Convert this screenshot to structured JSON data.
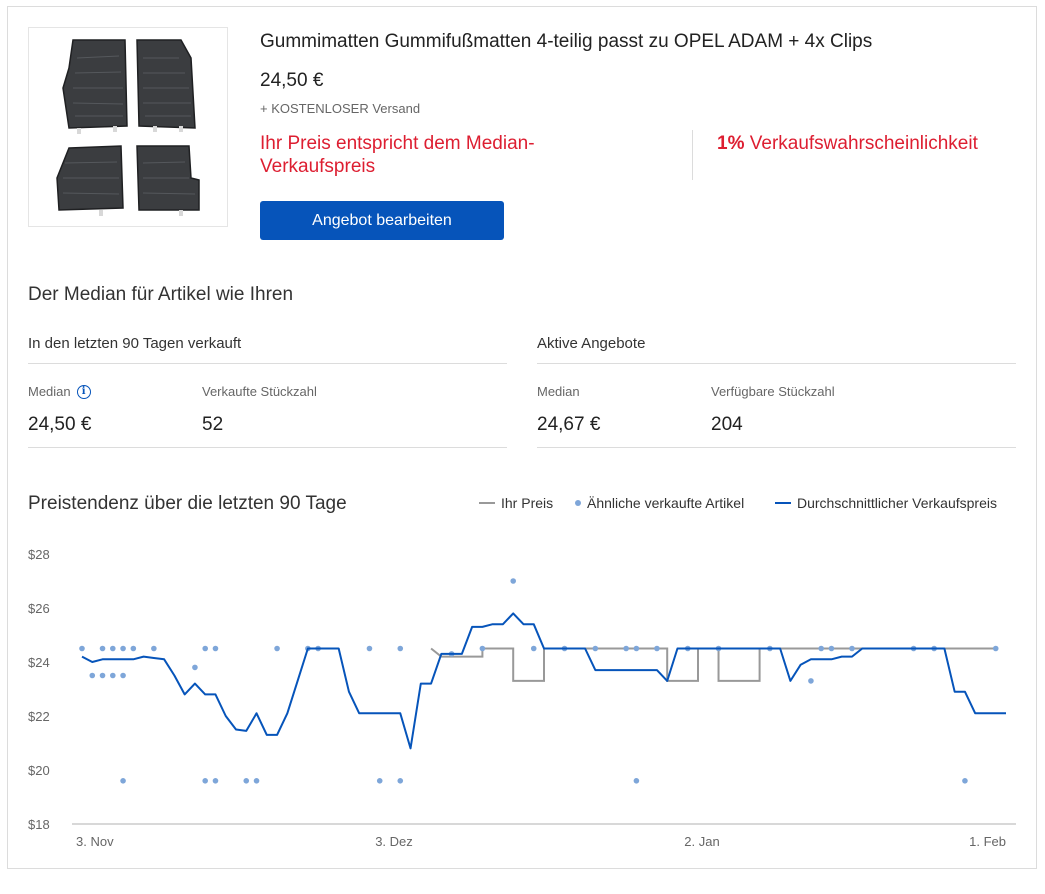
{
  "listing": {
    "title": "Gummimatten Gummifußmatten 4-teilig passt zu OPEL ADAM + 4x Clips",
    "price": "24,50 €",
    "shipping": "+ KOSTENLOSER Versand",
    "median_note": "Ihr Preis entspricht dem Median-Verkaufspreis",
    "probability_value": "1%",
    "probability_label": "Verkaufswahrscheinlichkeit",
    "edit_button": "Angebot bearbeiten"
  },
  "median_section": {
    "title": "Der Median für Artikel wie Ihren",
    "sold": {
      "heading": "In den letzten 90 Tagen verkauft",
      "median_label": "Median",
      "median_value": "24,50 €",
      "count_label": "Verkaufte Stückzahl",
      "count_value": "52"
    },
    "active": {
      "heading": "Aktive Angebote",
      "median_label": "Median",
      "median_value": "24,67 €",
      "count_label": "Verfügbare Stückzahl",
      "count_value": "204"
    }
  },
  "colors": {
    "accent": "#0654ba",
    "alert": "#dd1e31",
    "your_price_line": "#999999",
    "dots": "#7ea6d9",
    "avg_line": "#0654ba"
  },
  "chart_data": {
    "type": "line",
    "title": "Preistendenz über die letzten 90 Tage",
    "ylim": [
      18,
      28
    ],
    "y_ticks": [
      "$28",
      "$26",
      "$24",
      "$22",
      "$20",
      "$18"
    ],
    "y_tick_values": [
      28,
      26,
      24,
      22,
      20,
      18
    ],
    "x_range": [
      0,
      90
    ],
    "x_ticks": [
      {
        "label": "3. Nov",
        "day": 0
      },
      {
        "label": "3. Dez",
        "day": 30
      },
      {
        "label": "2. Jan",
        "day": 60
      },
      {
        "label": "1. Feb",
        "day": 89
      }
    ],
    "legend": [
      "Ihr Preis",
      "Ähnliche verkaufte Artikel",
      "Durchschnittlicher Verkaufspreis"
    ],
    "series": [
      {
        "name": "Ihr Preis",
        "type": "step",
        "points": [
          [
            34,
            24.5
          ],
          [
            35,
            24.2
          ],
          [
            39,
            24.2
          ],
          [
            39,
            24.5
          ],
          [
            42,
            24.5
          ],
          [
            42,
            23.3
          ],
          [
            45,
            23.3
          ],
          [
            45,
            24.5
          ],
          [
            57,
            24.5
          ],
          [
            57,
            23.3
          ],
          [
            60,
            23.3
          ],
          [
            60,
            24.5
          ],
          [
            62,
            24.5
          ],
          [
            62,
            23.3
          ],
          [
            66,
            23.3
          ],
          [
            66,
            24.5
          ],
          [
            89,
            24.5
          ]
        ]
      },
      {
        "name": "Ähnliche verkaufte Artikel",
        "type": "scatter",
        "points": [
          [
            0,
            24.5
          ],
          [
            1,
            23.5
          ],
          [
            2,
            24.5
          ],
          [
            2,
            23.5
          ],
          [
            3,
            24.5
          ],
          [
            3,
            23.5
          ],
          [
            4,
            24.5
          ],
          [
            4,
            23.5
          ],
          [
            4,
            19.6
          ],
          [
            5,
            24.5
          ],
          [
            7,
            24.5
          ],
          [
            11,
            23.8
          ],
          [
            12,
            24.5
          ],
          [
            12,
            19.6
          ],
          [
            13,
            24.5
          ],
          [
            13,
            19.6
          ],
          [
            16,
            19.6
          ],
          [
            17,
            19.6
          ],
          [
            19,
            24.5
          ],
          [
            22,
            24.5
          ],
          [
            23,
            24.5
          ],
          [
            28,
            24.5
          ],
          [
            29,
            19.6
          ],
          [
            31,
            24.5
          ],
          [
            31,
            19.6
          ],
          [
            36,
            24.3
          ],
          [
            39,
            24.5
          ],
          [
            42,
            27
          ],
          [
            44,
            24.5
          ],
          [
            47,
            24.5
          ],
          [
            50,
            24.5
          ],
          [
            53,
            24.5
          ],
          [
            54,
            24.5
          ],
          [
            54,
            19.6
          ],
          [
            56,
            24.5
          ],
          [
            59,
            24.5
          ],
          [
            62,
            24.5
          ],
          [
            67,
            24.5
          ],
          [
            71,
            23.3
          ],
          [
            72,
            24.5
          ],
          [
            73,
            24.5
          ],
          [
            75,
            24.5
          ],
          [
            81,
            24.5
          ],
          [
            83,
            24.5
          ],
          [
            86,
            19.6
          ],
          [
            89,
            24.5
          ]
        ]
      },
      {
        "name": "Durchschnittlicher Verkaufspreis",
        "type": "line",
        "points": [
          [
            0,
            24.2
          ],
          [
            1,
            24.0
          ],
          [
            2,
            24.1
          ],
          [
            3,
            24.1
          ],
          [
            4,
            24.1
          ],
          [
            5,
            24.1
          ],
          [
            6,
            24.2
          ],
          [
            7,
            24.15
          ],
          [
            8,
            24.1
          ],
          [
            9,
            23.5
          ],
          [
            10,
            22.8
          ],
          [
            11,
            23.2
          ],
          [
            12,
            22.8
          ],
          [
            13,
            22.8
          ],
          [
            14,
            22.0
          ],
          [
            15,
            21.5
          ],
          [
            16,
            21.45
          ],
          [
            17,
            22.1
          ],
          [
            18,
            21.3
          ],
          [
            19,
            21.3
          ],
          [
            20,
            22.1
          ],
          [
            21,
            23.3
          ],
          [
            22,
            24.5
          ],
          [
            23,
            24.5
          ],
          [
            24,
            24.5
          ],
          [
            25,
            24.5
          ],
          [
            26,
            22.9
          ],
          [
            27,
            22.1
          ],
          [
            28,
            22.1
          ],
          [
            29,
            22.1
          ],
          [
            30,
            22.1
          ],
          [
            31,
            22.1
          ],
          [
            32,
            20.8
          ],
          [
            33,
            23.2
          ],
          [
            34,
            23.2
          ],
          [
            35,
            24.3
          ],
          [
            36,
            24.3
          ],
          [
            37,
            24.3
          ],
          [
            38,
            25.3
          ],
          [
            39,
            25.3
          ],
          [
            40,
            25.4
          ],
          [
            41,
            25.4
          ],
          [
            42,
            25.8
          ],
          [
            43,
            25.4
          ],
          [
            44,
            25.4
          ],
          [
            45,
            24.5
          ],
          [
            46,
            24.5
          ],
          [
            47,
            24.5
          ],
          [
            48,
            24.5
          ],
          [
            49,
            24.5
          ],
          [
            50,
            23.7
          ],
          [
            51,
            23.7
          ],
          [
            52,
            23.7
          ],
          [
            53,
            23.7
          ],
          [
            54,
            23.7
          ],
          [
            55,
            23.7
          ],
          [
            56,
            23.7
          ],
          [
            57,
            23.3
          ],
          [
            58,
            24.5
          ],
          [
            59,
            24.5
          ],
          [
            60,
            24.5
          ],
          [
            61,
            24.5
          ],
          [
            62,
            24.5
          ],
          [
            63,
            24.5
          ],
          [
            64,
            24.5
          ],
          [
            65,
            24.5
          ],
          [
            66,
            24.5
          ],
          [
            67,
            24.5
          ],
          [
            68,
            24.5
          ],
          [
            69,
            23.3
          ],
          [
            70,
            23.9
          ],
          [
            71,
            24.1
          ],
          [
            72,
            24.1
          ],
          [
            73,
            24.1
          ],
          [
            74,
            24.2
          ],
          [
            75,
            24.2
          ],
          [
            76,
            24.5
          ],
          [
            77,
            24.5
          ],
          [
            78,
            24.5
          ],
          [
            79,
            24.5
          ],
          [
            80,
            24.5
          ],
          [
            81,
            24.5
          ],
          [
            82,
            24.5
          ],
          [
            83,
            24.5
          ],
          [
            84,
            24.5
          ],
          [
            85,
            22.9
          ],
          [
            86,
            22.9
          ],
          [
            87,
            22.1
          ],
          [
            88,
            22.1
          ],
          [
            89,
            22.1
          ],
          [
            90,
            22.1
          ]
        ]
      }
    ]
  }
}
